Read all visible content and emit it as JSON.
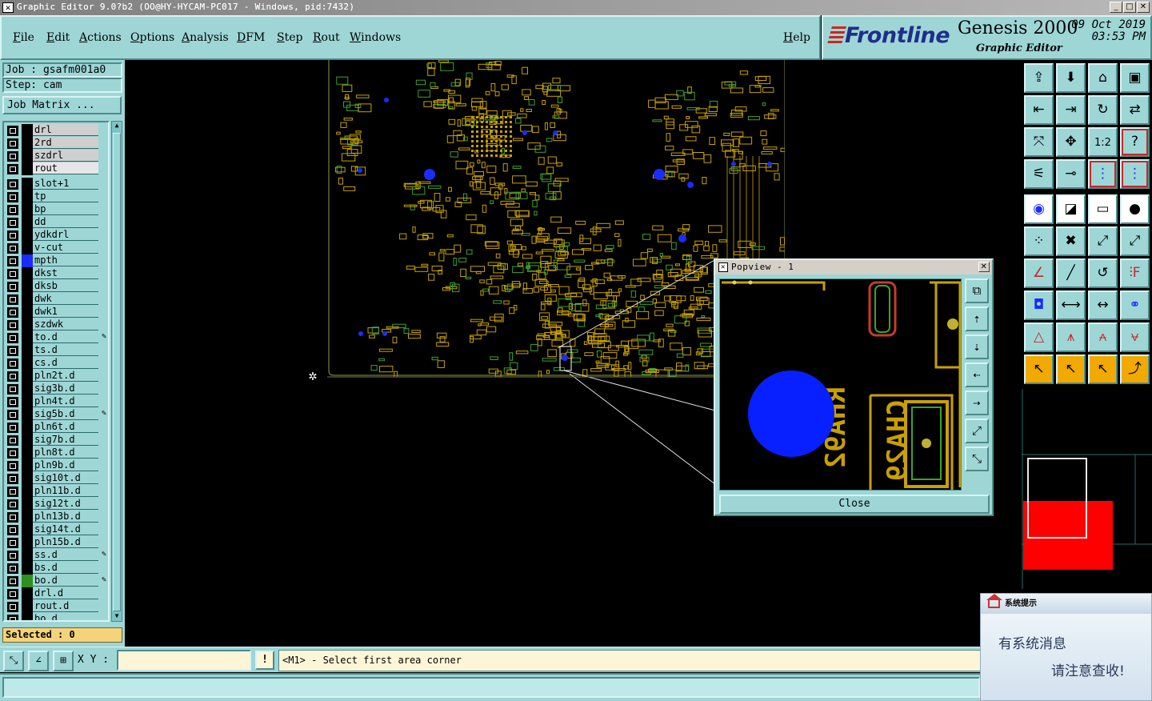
{
  "window": {
    "title": "Graphic Editor 9.0?b2 (OO@HY-HYCAM-PC017 - Windows, pid:7432)",
    "controls": [
      "_",
      "□",
      "✕"
    ]
  },
  "menu": {
    "items": [
      "File",
      "Edit",
      "Actions",
      "Options",
      "Analysis",
      "DFM",
      "Step",
      "Rout",
      "Windows"
    ],
    "help": "Help"
  },
  "brand": {
    "logo": "Frontline",
    "product": "Genesis 2000",
    "subtitle": "Graphic Editor",
    "date": "09 Oct 2019",
    "time": "03:53 PM",
    "colors": {
      "logo_text": "#1e2f8a",
      "logo_stripes": "#d0251b"
    }
  },
  "job": {
    "job_label": "Job : gsafm001a0",
    "step_label": "Step: cam",
    "matrix_button": "Job Matrix ..."
  },
  "layers": [
    {
      "name": "drl",
      "color": "#000000",
      "board": true
    },
    {
      "name": "2rd",
      "color": "#000000",
      "board": true
    },
    {
      "name": "szdrl",
      "color": "#000000",
      "board": true
    },
    {
      "name": "rout",
      "color": "#000000",
      "hi": true
    },
    {
      "name": "slot+1",
      "color": "#000000"
    },
    {
      "name": "tp",
      "color": "#000000"
    },
    {
      "name": "bp",
      "color": "#000000"
    },
    {
      "name": "dd",
      "color": "#000000"
    },
    {
      "name": "ydkdrl",
      "color": "#000000"
    },
    {
      "name": "v-cut",
      "color": "#000000"
    },
    {
      "name": "mpth",
      "color": "#1a2cff"
    },
    {
      "name": "dkst",
      "color": "#000000"
    },
    {
      "name": "dksb",
      "color": "#000000"
    },
    {
      "name": "dwk",
      "color": "#000000"
    },
    {
      "name": "dwk1",
      "color": "#000000"
    },
    {
      "name": "szdwk",
      "color": "#000000"
    },
    {
      "name": "to.d",
      "color": "#000000",
      "pen": true
    },
    {
      "name": "ts.d",
      "color": "#000000"
    },
    {
      "name": "cs.d",
      "color": "#000000"
    },
    {
      "name": "pln2t.d",
      "color": "#000000"
    },
    {
      "name": "sig3b.d",
      "color": "#000000"
    },
    {
      "name": "pln4t.d",
      "color": "#000000"
    },
    {
      "name": "sig5b.d",
      "color": "#000000",
      "pen": true
    },
    {
      "name": "pln6t.d",
      "color": "#000000"
    },
    {
      "name": "sig7b.d",
      "color": "#000000"
    },
    {
      "name": "pln8t.d",
      "color": "#000000"
    },
    {
      "name": "pln9b.d",
      "color": "#000000"
    },
    {
      "name": "sig10t.d",
      "color": "#000000"
    },
    {
      "name": "pln11b.d",
      "color": "#000000"
    },
    {
      "name": "sig12t.d",
      "color": "#000000"
    },
    {
      "name": "pln13b.d",
      "color": "#000000"
    },
    {
      "name": "sig14t.d",
      "color": "#000000"
    },
    {
      "name": "pln15b.d",
      "color": "#000000"
    },
    {
      "name": "ss.d",
      "color": "#000000",
      "pen": true
    },
    {
      "name": "bs.d",
      "color": "#000000"
    },
    {
      "name": "bo.d",
      "color": "#2f8f1f",
      "pen": true
    },
    {
      "name": "drl.d",
      "color": "#000000"
    },
    {
      "name": "rout.d",
      "color": "#000000"
    },
    {
      "name": "bo.d",
      "color": "#000000"
    }
  ],
  "selected_label": "Selected : 0",
  "popview": {
    "title": "Popview - 1",
    "close_label": "Close",
    "silk_text_1": "RHA92",
    "silk_text_2": "CHA29",
    "tools": [
      "zoom-fit",
      "page-up",
      "page-down",
      "page-left",
      "page-right",
      "zoom-out",
      "zoom-in"
    ]
  },
  "status": {
    "xy_label": "X Y :",
    "xy_value": "",
    "message": "<M1> - Select first area corner"
  },
  "notification": {
    "header": "系统提示",
    "line1": "有系统消息",
    "line2": "请注意查收!"
  },
  "toolbox": {
    "rows": [
      [
        "open-icon",
        "save-icon",
        "home-icon",
        "window-icon"
      ],
      [
        "import-icon",
        "export-icon",
        "rotate-icon",
        "mirror-icon"
      ],
      [
        "zoom-fit-icon",
        "zoom-home-icon",
        "ratio-icon",
        "help-icon"
      ],
      [
        "measure-icon",
        "drill-icon",
        "net-icon",
        "net2-icon"
      ],
      [
        "select-point-icon",
        "draw-line-icon",
        "ruler-icon",
        "pad-icon"
      ],
      [
        "snap-grid-icon",
        "delete-icon",
        "move-icon",
        "move2-icon"
      ],
      [
        "angle-icon",
        "line-icon",
        "arc-icon",
        "text-icon"
      ],
      [
        "pad-select-icon",
        "split-icon",
        "measure-dist-icon",
        "connect-icon"
      ],
      [
        "triangle-icon",
        "triangle2-icon",
        "triangle3-icon",
        "triangle4-icon"
      ],
      [
        "pointer-icon",
        "pointer-box-icon",
        "pointer-select-icon",
        "pointer-net-icon"
      ]
    ],
    "button_labels": {
      "ratio": "1:2"
    }
  }
}
